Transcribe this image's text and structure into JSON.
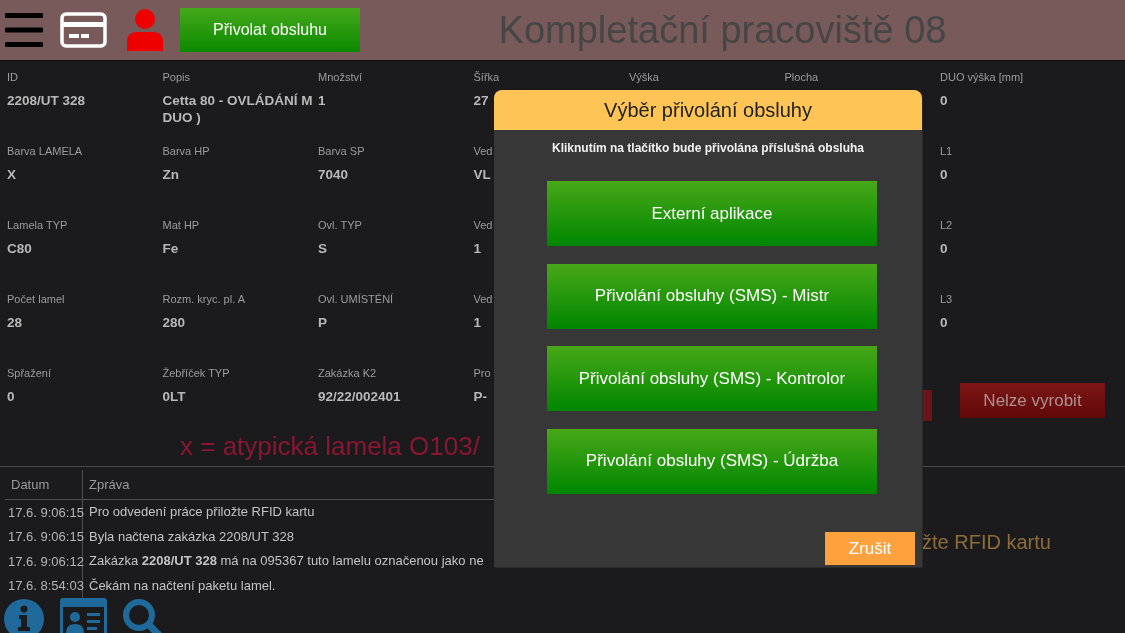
{
  "header": {
    "call_button": "Přivolat obsluhu",
    "title": "Kompletační pracoviště 08"
  },
  "detail_columns": [
    [
      {
        "label": "ID",
        "value": "2208/UT 328"
      },
      {
        "label": "Barva LAMELA",
        "value": "X"
      },
      {
        "label": "Lamela TYP",
        "value": "C80"
      },
      {
        "label": "Počet lamel",
        "value": "28"
      },
      {
        "label": "Spřažení",
        "value": "0"
      }
    ],
    [
      {
        "label": "Popis",
        "value": "Cetta 80 - OVLÁDÁNÍ M DUO )"
      },
      {
        "label": "Barva HP",
        "value": "Zn"
      },
      {
        "label": "Mat HP",
        "value": "Fe"
      },
      {
        "label": "Rozm. kryc. pl. A",
        "value": "280"
      },
      {
        "label": "Žebříček TYP",
        "value": "0LT"
      }
    ],
    [
      {
        "label": "Množství",
        "value": "1"
      },
      {
        "label": "Barva SP",
        "value": "7040"
      },
      {
        "label": "Ovl. TYP",
        "value": "S"
      },
      {
        "label": "Ovl. UMÍSTĚNÍ",
        "value": "P"
      },
      {
        "label": "Zakázka K2",
        "value": "92/22/002401"
      }
    ],
    [
      {
        "label": "Šířka",
        "value": "27"
      },
      {
        "label": "Ved",
        "value": "VL"
      },
      {
        "label": "Ved",
        "value": "1"
      },
      {
        "label": "Ved",
        "value": "1"
      },
      {
        "label": "Pro",
        "value": "P-"
      }
    ],
    [
      {
        "label": "Výška"
      }
    ],
    [
      {
        "label": "Plocha"
      }
    ],
    [
      {
        "label": "DUO výška [mm]",
        "value": "0"
      },
      {
        "label": "L1",
        "value": "0"
      },
      {
        "label": "L2",
        "value": "0"
      },
      {
        "label": "L3",
        "value": "0"
      }
    ]
  ],
  "actions": [
    {
      "kind": "covered"
    },
    {
      "kind": "button",
      "label": "Nelze vyrobit"
    }
  ],
  "warning": "x = atypická lamela O103/",
  "log": {
    "columns": [
      "Datum",
      "Zpráva"
    ],
    "rows": [
      {
        "time": "17.6. 9:06:15",
        "message": "Pro odvedení práce přiložte RFID kartu"
      },
      {
        "time": "17.6. 9:06:15",
        "message": "Byla načtena zakázka 2208/UT 328"
      },
      {
        "time": "17.6. 9:06:12",
        "message": "Zakázka **2208/UT 328** má na 095367 tuto lamelu označenou jako ne"
      },
      {
        "time": "17.6. 8:54:03",
        "message": "Čekám na načtení paketu lamel."
      }
    ]
  },
  "status_message": "žte RFID kartu",
  "dialog": {
    "title": "Výběr přivolání obsluhy",
    "subtitle": "Kliknutím na tlačítko bude přivolána příslušná obsluha",
    "options": [
      "Externí aplikace",
      "Přivolání obsluhy (SMS) - Mistr",
      "Přivolání obsluhy (SMS) - Kontrolor",
      "Přivolání obsluhy (SMS) - Údržba"
    ],
    "cancel": "Zrušit"
  }
}
